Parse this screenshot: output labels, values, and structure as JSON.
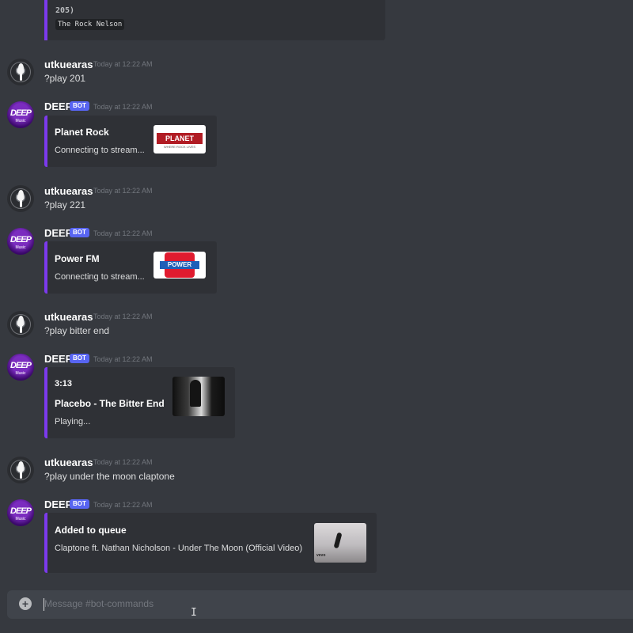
{
  "top_embed": {
    "line1": "205)",
    "code": "The Rock Nelson"
  },
  "messages": [
    {
      "user": "utkuearas",
      "timestamp": "Today at 12:22 AM",
      "text": "?play 201"
    },
    {
      "user": "DEEP",
      "bot_tag": "BOT",
      "timestamp": "Today at 12:22 AM",
      "embed": {
        "title": "Planet Rock",
        "desc": "Connecting to stream...",
        "thumb_text": "PLANET ROCK",
        "thumb_sub": "WHERE ROCK LIVES"
      }
    },
    {
      "user": "utkuearas",
      "timestamp": "Today at 12:22 AM",
      "text": "?play 221"
    },
    {
      "user": "DEEP",
      "bot_tag": "BOT",
      "timestamp": "Today at 12:22 AM",
      "embed": {
        "title": "Power FM",
        "desc": "Connecting to stream...",
        "thumb_text": "POWER"
      }
    },
    {
      "user": "utkuearas",
      "timestamp": "Today at 12:22 AM",
      "text": "?play bitter end"
    },
    {
      "user": "DEEP",
      "bot_tag": "BOT",
      "timestamp": "Today at 12:22 AM",
      "embed": {
        "duration": "3:13",
        "title": "Placebo - The Bitter End",
        "desc": "Playing..."
      }
    },
    {
      "user": "utkuearas",
      "timestamp": "Today at 12:22 AM",
      "text": "?play under the moon claptone"
    },
    {
      "user": "DEEP",
      "bot_tag": "BOT",
      "timestamp": "Today at 12:22 AM",
      "embed": {
        "title": "Added to queue",
        "desc": "Claptone ft. Nathan Nicholson - Under The Moon (Official Video)",
        "thumb_text": "vevo"
      }
    }
  ],
  "bot_avatar": {
    "logo": "DEEP",
    "sub": "Music"
  },
  "composer": {
    "placeholder": "Message #bot-commands",
    "plus": "+"
  },
  "colors": {
    "background": "#36393f",
    "embed": "#2f3136",
    "accent": "#7c3aed",
    "bot_tag": "#5865f2"
  }
}
